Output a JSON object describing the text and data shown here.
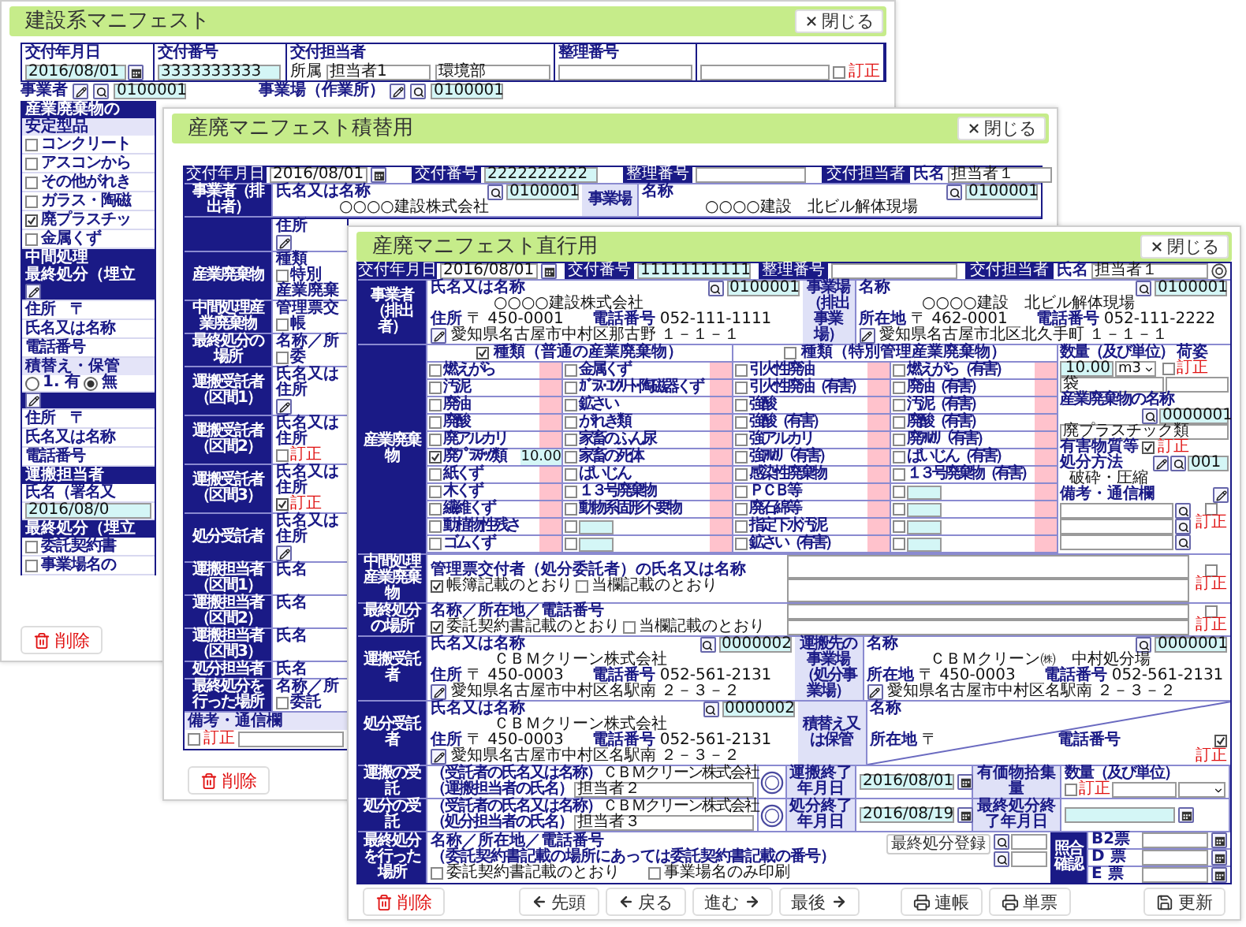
{
  "back_window_1": {
    "title": "建設系マニフェスト",
    "close_label": "閉じる",
    "delete_label": "削除",
    "header": {
      "date_label": "交付年月日",
      "date": "2016/08/01",
      "number_label": "交付番号",
      "number": "3333333333",
      "staff_label": "交付担当者",
      "dept_label": "所属",
      "staff": "担当者1",
      "dept": "環境部",
      "ref_label": "整理番号",
      "correction": {
        "label": "訂正",
        "checked": false
      }
    },
    "issuer_label": "事業者",
    "issuer_code": "0100001",
    "site_label": "事業場（作業所）",
    "site_code": "0100001",
    "strip": [
      {
        "kind": "header",
        "text": "産業廃棄物の"
      },
      {
        "kind": "subheader",
        "text": "安定型品"
      },
      {
        "kind": "check",
        "text": "コンクリート",
        "checked": false
      },
      {
        "kind": "check",
        "text": "アスコンから",
        "checked": false
      },
      {
        "kind": "check",
        "text": "その他がれき",
        "checked": false
      },
      {
        "kind": "check",
        "text": "ガラス・陶磁",
        "checked": false
      },
      {
        "kind": "check",
        "text": "廃プラスチッ",
        "checked": true
      },
      {
        "kind": "check",
        "text": "金属くず",
        "checked": false
      },
      {
        "kind": "header",
        "text": "中間処理"
      },
      {
        "kind": "header",
        "text": "最終処分（埋立"
      },
      {
        "kind": "tool"
      },
      {
        "kind": "text",
        "text": "住所　〒"
      },
      {
        "kind": "text",
        "text": "氏名又は名称"
      },
      {
        "kind": "text",
        "text": "電話番号"
      },
      {
        "kind": "subheader",
        "text": "積替え・保管"
      },
      {
        "kind": "radio",
        "options": [
          {
            "label": "1. 有",
            "selected": false
          },
          {
            "label": "無",
            "selected": true
          }
        ]
      },
      {
        "kind": "tool"
      },
      {
        "kind": "text",
        "text": "住所　〒"
      },
      {
        "kind": "text",
        "text": "氏名又は名称"
      },
      {
        "kind": "text",
        "text": "電話番号"
      },
      {
        "kind": "header",
        "text": "運搬担当者"
      },
      {
        "kind": "text",
        "text": "氏名（署名又"
      },
      {
        "kind": "field",
        "text": "2016/08/0"
      },
      {
        "kind": "header",
        "text": "最終処分（埋立"
      },
      {
        "kind": "check",
        "text": "委託契約書",
        "checked": false
      },
      {
        "kind": "check",
        "text": "事業場名の",
        "checked": false
      }
    ]
  },
  "back_window_2": {
    "title": "産廃マニフェスト積替用",
    "close_label": "閉じる",
    "delete_label": "削除",
    "header": {
      "date_label": "交付年月日",
      "date": "2016/08/01",
      "number_label": "交付番号",
      "number": "2222222222",
      "ref_label": "整理番号",
      "staff_label": "交付担当者",
      "name_label": "氏名",
      "staff": "担当者１"
    },
    "issuer": {
      "side_label": "事業者（排出者）",
      "name_label": "氏名又は名称",
      "code": "0100001",
      "name": "○○○○建設株式会社"
    },
    "site": {
      "side_label": "事業場",
      "name_label": "名称",
      "name": "○○○○建設　北ビル解体現場",
      "code": "0100001"
    },
    "blocks": [
      {
        "items": [
          {
            "kind": "text",
            "text": "住所"
          },
          {
            "kind": "edit"
          }
        ]
      },
      {
        "label": "産業廃棄物",
        "items": [
          {
            "kind": "text",
            "text": "種類"
          },
          {
            "kind": "check",
            "text": "特別",
            "checked": false
          },
          {
            "kind": "text",
            "text": "産業廃棄"
          }
        ]
      },
      {
        "label": "中間処理産業廃棄物",
        "items": [
          {
            "kind": "text",
            "text": "管理票交"
          },
          {
            "kind": "check",
            "text": "帳",
            "checked": false
          }
        ]
      },
      {
        "label": "最終処分の場所",
        "items": [
          {
            "kind": "text",
            "text": "名称／所"
          },
          {
            "kind": "check",
            "text": "委",
            "checked": false
          }
        ]
      },
      {
        "label": "運搬受託者（区間1）",
        "items": [
          {
            "kind": "text",
            "text": "氏名又は"
          },
          {
            "kind": "text",
            "text": "住所"
          },
          {
            "kind": "edit"
          }
        ]
      },
      {
        "label": "運搬受託者（区間2）",
        "items": [
          {
            "kind": "text",
            "text": "氏名又は"
          },
          {
            "kind": "text",
            "text": "住所"
          },
          {
            "kind": "correction",
            "text": "訂正",
            "checked": false
          }
        ]
      },
      {
        "label": "運搬受託者（区間3）",
        "items": [
          {
            "kind": "text",
            "text": "氏名又は"
          },
          {
            "kind": "text",
            "text": "住所"
          },
          {
            "kind": "correction",
            "text": "訂正",
            "checked": true
          }
        ]
      },
      {
        "label": "処分受託者",
        "items": [
          {
            "kind": "text",
            "text": "氏名又は"
          },
          {
            "kind": "text",
            "text": "住所"
          },
          {
            "kind": "edit"
          }
        ]
      },
      {
        "label": "運搬担当者（区間1）",
        "items": [
          {
            "kind": "text",
            "text": "氏名"
          }
        ]
      },
      {
        "label": "運搬担当者（区間2）",
        "items": [
          {
            "kind": "text",
            "text": "氏名"
          }
        ]
      },
      {
        "label": "運搬担当者（区間3）",
        "items": [
          {
            "kind": "text",
            "text": "氏名"
          }
        ]
      },
      {
        "label": "処分担当者",
        "items": [
          {
            "kind": "text",
            "text": "氏名"
          }
        ]
      },
      {
        "label": "最終処分を行った場所",
        "items": [
          {
            "kind": "text",
            "text": "名称／所"
          },
          {
            "kind": "check",
            "text": "委託",
            "checked": false
          }
        ]
      }
    ],
    "remarks_label": "備考・通信欄",
    "remarks_correction": {
      "label": "訂正",
      "checked": false
    }
  },
  "front_window": {
    "title": "産廃マニフェスト直行用",
    "close_label": "閉じる",
    "header": {
      "date_label": "交付年月日",
      "date": "2016/08/01",
      "number_label": "交付番号",
      "number": "11111111111",
      "ref_label": "整理番号",
      "staff_label": "交付担当者",
      "name_label": "氏名",
      "staff": "担当者１"
    },
    "issuer": {
      "side_label": "事業者（排出者）",
      "name_label": "氏名又は名称",
      "code": "0100001",
      "name": "○○○○建設株式会社",
      "address_label": "住所",
      "postal": "〒 450-0001",
      "phone_label": "電話番号",
      "phone": "052-111-1111",
      "address": "愛知県名古屋市中村区那古野",
      "address2": "１－１－１"
    },
    "site_side_label": "事業場（排出事業場）",
    "site": {
      "name_label": "名称",
      "code": "0100001",
      "name": "○○○○建設　北ビル解体現場",
      "address_label": "所在地",
      "postal": "〒 462-0001",
      "phone_label": "電話番号",
      "phone": "052-111-2222",
      "address": "愛知県名古屋市北区北久手町",
      "address2": "１－１－１"
    },
    "waste": {
      "side_label": "産業廃棄物",
      "groups": [
        {
          "label": "種類（普通の産業廃棄物）",
          "checked": true
        },
        {
          "label": "種類（特別管理産業廃棄物）",
          "checked": false
        }
      ],
      "columns": [
        [
          {
            "kind": "waste",
            "label": "燃えがら",
            "checked": false
          },
          {
            "kind": "waste",
            "label": "汚泥",
            "checked": false
          },
          {
            "kind": "waste",
            "label": "廃油",
            "checked": false
          },
          {
            "kind": "waste",
            "label": "廃酸",
            "checked": false
          },
          {
            "kind": "waste",
            "label": "廃アルカリ",
            "checked": false
          },
          {
            "kind": "waste",
            "label": "廃ﾌﾟﾗｽﾁｯｸ類",
            "checked": true,
            "amount": "10.00"
          },
          {
            "kind": "waste",
            "label": "紙くず",
            "checked": false
          },
          {
            "kind": "waste",
            "label": "木くず",
            "checked": false
          },
          {
            "kind": "waste",
            "label": "繊維くず",
            "checked": false
          },
          {
            "kind": "waste",
            "label": "動植物性残さ",
            "checked": false
          },
          {
            "kind": "waste",
            "label": "ゴムくず",
            "checked": false
          }
        ],
        [
          {
            "kind": "waste",
            "label": "金属くず",
            "checked": false
          },
          {
            "kind": "waste",
            "label": "ｶﾞﾗｽ･ｺﾝｸﾘｰﾄ･陶磁器くず",
            "checked": false
          },
          {
            "kind": "waste",
            "label": "鉱さい",
            "checked": false
          },
          {
            "kind": "waste",
            "label": "がれき類",
            "checked": false
          },
          {
            "kind": "waste",
            "label": "家畜のふん尿",
            "checked": false
          },
          {
            "kind": "waste",
            "label": "家畜の死体",
            "checked": false
          },
          {
            "kind": "waste",
            "label": "ばいじん",
            "checked": false
          },
          {
            "kind": "waste",
            "label": "１３号廃棄物",
            "checked": false
          },
          {
            "kind": "waste",
            "label": "動物系固形不要物",
            "checked": false
          },
          {
            "kind": "custom",
            "checked": false
          },
          {
            "kind": "custom",
            "checked": false
          }
        ],
        [
          {
            "kind": "waste",
            "label": "引火性廃油",
            "checked": false
          },
          {
            "kind": "waste",
            "label": "引火性廃油（有害）",
            "checked": false
          },
          {
            "kind": "waste",
            "label": "強酸",
            "checked": false
          },
          {
            "kind": "waste",
            "label": "強酸（有害）",
            "checked": false
          },
          {
            "kind": "waste",
            "label": "強アルカリ",
            "checked": false
          },
          {
            "kind": "waste",
            "label": "強ｱﾙｶﾘ（有害）",
            "checked": false
          },
          {
            "kind": "waste",
            "label": "感染性廃棄物",
            "checked": false
          },
          {
            "kind": "waste",
            "label": "ＰＣＢ等",
            "checked": false
          },
          {
            "kind": "waste",
            "label": "廃石綿等",
            "checked": false
          },
          {
            "kind": "waste",
            "label": "指定下水汚泥",
            "checked": false
          },
          {
            "kind": "waste",
            "label": "鉱さい（有害）",
            "checked": false
          }
        ],
        [
          {
            "kind": "waste",
            "label": "燃えがら（有害）",
            "checked": false
          },
          {
            "kind": "waste",
            "label": "廃油（有害）",
            "checked": false
          },
          {
            "kind": "waste",
            "label": "汚泥（有害）",
            "checked": false
          },
          {
            "kind": "waste",
            "label": "廃酸（有害）",
            "checked": false
          },
          {
            "kind": "waste",
            "label": "廃ｱﾙｶﾘ（有害）",
            "checked": false
          },
          {
            "kind": "waste",
            "label": "ばいじん（有害）",
            "checked": false
          },
          {
            "kind": "waste",
            "label": "１３号廃棄物（有害）",
            "checked": false
          },
          {
            "kind": "custom",
            "checked": false
          },
          {
            "kind": "custom",
            "checked": false
          },
          {
            "kind": "custom",
            "checked": false
          },
          {
            "kind": "custom",
            "checked": false
          }
        ]
      ],
      "qty_label": "数量（及び単位）",
      "qty": "10.00",
      "unit": "m3",
      "packing_label": "荷姿",
      "packing_correction": {
        "label": "訂正",
        "checked": false
      },
      "packing": "袋",
      "name_label": "産業廃棄物の名称",
      "name_code": "0000001",
      "name": "廃プラスチック類",
      "hazard_label": "有害物質等",
      "hazard_correction": {
        "label": "訂正",
        "checked": true
      },
      "method_label": "処分方法",
      "method_code": "001",
      "method": "破砕・圧縮",
      "remarks_label": "備考・通信欄",
      "remarks_correction": {
        "label": "訂正",
        "checked": false
      }
    },
    "intermediate": {
      "side_label": "中間処理産業廃棄物",
      "label": "管理票交付者（処分委託者）の氏名又は名称",
      "options": [
        {
          "label": "帳簿記載のとおり",
          "checked": true
        },
        {
          "label": "当欄記載のとおり",
          "checked": false
        }
      ],
      "correction": {
        "label": "訂正",
        "checked": false
      }
    },
    "final_site": {
      "side_label": "最終処分の場所",
      "label": "名称／所在地／電話番号",
      "options": [
        {
          "label": "委託契約書記載のとおり",
          "checked": true
        },
        {
          "label": "当欄記載のとおり",
          "checked": false
        }
      ],
      "correction": {
        "label": "訂正",
        "checked": false
      }
    },
    "carrier": {
      "side_label": "運搬受託者",
      "party": {
        "name_label": "氏名又は名称",
        "code": "0000002",
        "name": "ＣＢＭクリーン株式会社",
        "address_label": "住所",
        "postal": "〒 450-0003",
        "phone_label": "電話番号",
        "phone": "052-561-2131",
        "address": "愛知県名古屋市中村区名駅南",
        "address2": "２－３－２"
      },
      "dest_label": "運搬先の事業場（処分事業場）",
      "dest": {
        "name_label": "名称",
        "code": "0000001",
        "name": "ＣＢＭクリーン㈱　中村処分場",
        "address_label": "所在地",
        "postal": "〒 450-0003",
        "phone_label": "電話番号",
        "phone": "052-561-2131",
        "address": "愛知県名古屋市中村区名駅南",
        "address2": "２－３－２"
      }
    },
    "processor": {
      "side_label": "処分受託者",
      "party": {
        "name_label": "氏名又は名称",
        "code": "0000002",
        "name": "ＣＢＭクリーン株式会社",
        "address_label": "住所",
        "postal": "〒 450-0003",
        "phone_label": "電話番号",
        "phone": "052-561-2131",
        "address": "愛知県名古屋市中村区名駅南",
        "address2": "２－３－２"
      },
      "storage_label": "積替え又は保管",
      "storage": {
        "name_label": "名称",
        "address_label": "所在地",
        "postal": "〒",
        "phone_label": "電話番号",
        "correction": {
          "label": "訂正",
          "checked": true
        }
      }
    },
    "receipts": [
      {
        "kind": "transport",
        "side_label": "運搬の受託",
        "company_label": "（受託者の氏名又は名称）",
        "company": "ＣＢＭクリーン株式会社",
        "person_label": "（運搬担当者の氏名）",
        "person": "担当者２",
        "date_label": "運搬終了年月日",
        "date": "2016/08/01",
        "extra_label": "有価物拾集量",
        "qty_label": "数量（及び単位）",
        "correction": {
          "label": "訂正",
          "checked": false
        }
      },
      {
        "kind": "disposal",
        "side_label": "処分の受託",
        "company_label": "（受託者の氏名又は名称）",
        "company": "ＣＢＭクリーン株式会社",
        "person_label": "（処分担当者の氏名）",
        "person": "担当者３",
        "date_label": "処分終了年月日",
        "date": "2016/08/19",
        "extra_label": "最終処分終了年月日"
      }
    ],
    "final_place": {
      "side_label": "最終処分を行った場所",
      "label": "名称／所在地／電話番号",
      "note": "（委託契約書記載の場所にあっては委託契約書記載の番号）",
      "options": [
        {
          "label": "委託契約書記載のとおり",
          "checked": false
        },
        {
          "label": "事業場名のみ印刷",
          "checked": false
        }
      ],
      "register_button": "最終処分登録",
      "check_label": "照合確認",
      "tickets": [
        "B2票",
        "D 票",
        "E 票"
      ]
    },
    "delete_label": "削除",
    "nav_buttons": [
      {
        "label": "先頭",
        "kind": "back"
      },
      {
        "label": "戻る",
        "kind": "back"
      },
      {
        "label": "進む",
        "kind": "forward"
      },
      {
        "label": "最後",
        "kind": "forward"
      }
    ],
    "print_buttons": [
      {
        "label": "連帳",
        "kind": "print"
      },
      {
        "label": "単票",
        "kind": "print"
      }
    ],
    "update_button": "更新"
  }
}
